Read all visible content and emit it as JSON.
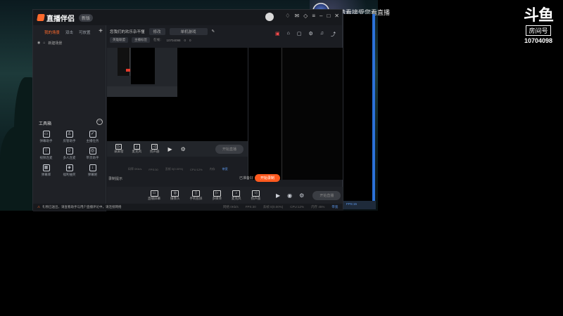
{
  "overlay": {
    "logo_mark": "斗鱼",
    "room_label": "房间号",
    "room_number": "10704098",
    "streamer_title": "请看接受您看直播"
  },
  "app": {
    "brand": "直播伴侣",
    "version": "新版",
    "scene_tabs": [
      "我的场景",
      "双击",
      "可放置"
    ],
    "scene_item": "新建场景",
    "toolbox_title": "工具箱",
    "tools": [
      {
        "icon": "danmu-icon",
        "label": "弹幕助手"
      },
      {
        "icon": "fan-icon",
        "label": "房管助手"
      },
      {
        "icon": "task-icon",
        "label": "主播任务"
      },
      {
        "icon": "game-icon",
        "label": "视频连麦"
      },
      {
        "icon": "user-icon",
        "label": "多人连麦"
      },
      {
        "icon": "shop-icon",
        "label": "带货助手"
      },
      {
        "icon": "comment-icon",
        "label": "弹幕库"
      },
      {
        "icon": "lottery-icon",
        "label": "福利抽奖"
      },
      {
        "icon": "download-icon",
        "label": "弹幕姬"
      }
    ],
    "room": {
      "title": "您我们的欢乐杂不懂",
      "edit_btn": "修改",
      "category_btn": "单机游戏",
      "tag1": "英雄联盟",
      "tag2": "主播标签",
      "meta1": "在线：",
      "meta2": "10704098",
      "meta3": "0",
      "meta4": "0"
    },
    "inner_toolbar": [
      {
        "icon": "screen-icon",
        "label": "录屏窗"
      },
      {
        "icon": "mic-icon",
        "label": "麦克风"
      },
      {
        "icon": "speaker-icon",
        "label": "扬声器"
      }
    ],
    "inner_go": "开始直播",
    "stats": {
      "bitrate": "码率 0Kb/s",
      "fps": "FPS:30",
      "drop": "丢帧 0(0.00%)",
      "cpu": "CPU:12%",
      "memory": "内存",
      "bandwidth": "带宽"
    },
    "record_label": "录制提示",
    "record_status": "已准备好",
    "record_btn": "开始录制",
    "bottom_toolbar": [
      {
        "icon": "live-screen-icon",
        "label": "直播屏幕"
      },
      {
        "icon": "camera-icon",
        "label": "摄像头"
      },
      {
        "icon": "phone-icon",
        "label": "手机投屏"
      },
      {
        "icon": "media-icon",
        "label": "多媒体"
      },
      {
        "icon": "mic-icon",
        "label": "麦克风"
      },
      {
        "icon": "speaker-icon",
        "label": "扬声器"
      }
    ],
    "bottom_go": "开始直播",
    "status_warning": "⚠",
    "status_text": "礼物已送出，请查看助手与用户直播评论中，请连接网络",
    "status_stats": {
      "bitrate": "网络 0Kb/s",
      "fps": "FPS:30",
      "drop": "丢帧 0(0.00%)",
      "cpu": "CPU:12%",
      "memory": "内存 45%",
      "bandwidth": "带宽"
    },
    "blue_pane_text": "FPS:15"
  }
}
